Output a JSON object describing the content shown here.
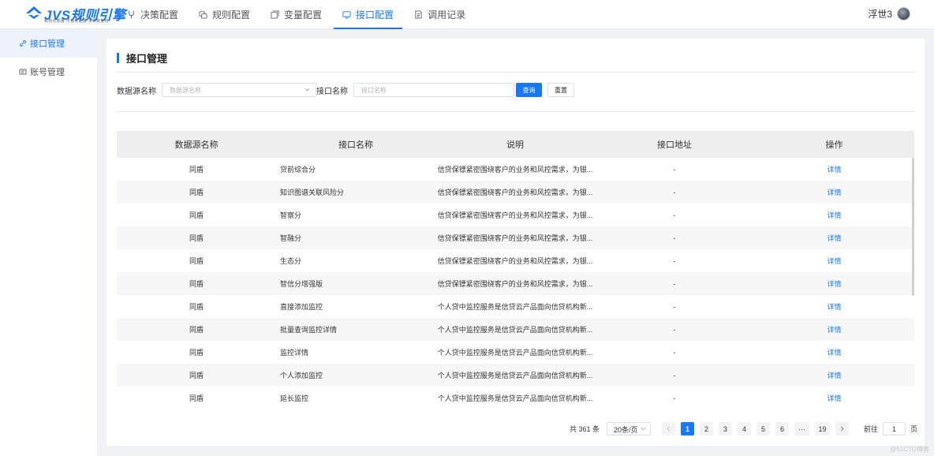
{
  "brand": {
    "name": "JVS规则引擎",
    "slogan": "私有化部署·可视化配置·多场景支持"
  },
  "nav": [
    {
      "label": "决策配置",
      "icon": "branch-icon",
      "active": false
    },
    {
      "label": "规则配置",
      "icon": "rules-icon",
      "active": false
    },
    {
      "label": "变量配置",
      "icon": "variable-icon",
      "active": false
    },
    {
      "label": "接口配置",
      "icon": "monitor-icon",
      "active": true
    },
    {
      "label": "调用记录",
      "icon": "document-icon",
      "active": false
    }
  ],
  "user": {
    "name": "浮世3"
  },
  "sidebar": [
    {
      "label": "接口管理",
      "icon": "link-icon",
      "active": true
    },
    {
      "label": "账号管理",
      "icon": "account-card-icon",
      "active": false
    }
  ],
  "page": {
    "title": "接口管理"
  },
  "filters": {
    "datasource_label": "数据源名称",
    "datasource_placeholder": "数据源名称",
    "api_label": "接口名称",
    "api_placeholder": "接口名称",
    "search_btn": "查询",
    "reset_btn": "重置"
  },
  "table": {
    "columns": [
      "数据源名称",
      "接口名称",
      "说明",
      "接口地址",
      "操作"
    ],
    "rows": [
      {
        "source": "同盾",
        "name": "贷前综合分",
        "desc": "信贷保镖紧密围绕客户的业务和风控需求，为银...",
        "url": "-",
        "action": "详情"
      },
      {
        "source": "同盾",
        "name": "知识图谱关联风险分",
        "desc": "信贷保镖紧密围绕客户的业务和风控需求，为银...",
        "url": "-",
        "action": "详情"
      },
      {
        "source": "同盾",
        "name": "智察分",
        "desc": "信贷保镖紧密围绕客户的业务和风控需求，为银...",
        "url": "-",
        "action": "详情"
      },
      {
        "source": "同盾",
        "name": "智融分",
        "desc": "信贷保镖紧密围绕客户的业务和风控需求，为银...",
        "url": "-",
        "action": "详情"
      },
      {
        "source": "同盾",
        "name": "生态分",
        "desc": "信贷保镖紧密围绕客户的业务和风控需求，为银...",
        "url": "-",
        "action": "详情"
      },
      {
        "source": "同盾",
        "name": "智信分增强版",
        "desc": "信贷保镖紧密围绕客户的业务和风控需求，为银...",
        "url": "-",
        "action": "详情"
      },
      {
        "source": "同盾",
        "name": "直接添加监控",
        "desc": "个人贷中监控服务是信贷云产品面向信贷机构新...",
        "url": "-",
        "action": "详情"
      },
      {
        "source": "同盾",
        "name": "批量查询监控详情",
        "desc": "个人贷中监控服务是信贷云产品面向信贷机构新...",
        "url": "-",
        "action": "详情"
      },
      {
        "source": "同盾",
        "name": "监控详情",
        "desc": "个人贷中监控服务是信贷云产品面向信贷机构新...",
        "url": "-",
        "action": "详情"
      },
      {
        "source": "同盾",
        "name": "个人添加监控",
        "desc": "个人贷中监控服务是信贷云产品面向信贷机构新...",
        "url": "-",
        "action": "详情"
      },
      {
        "source": "同盾",
        "name": "延长监控",
        "desc": "个人贷中监控服务是信贷云产品面向信贷机构新...",
        "url": "-",
        "action": "详情"
      }
    ]
  },
  "pagination": {
    "total_text": "共 361 条",
    "page_size": "20条/页",
    "pages": [
      "1",
      "2",
      "3",
      "4",
      "5",
      "6",
      "···",
      "19"
    ],
    "current": "1",
    "goto_label": "前往",
    "goto_value": "1",
    "goto_suffix": "页"
  },
  "watermark": "@51CTO博客",
  "colors": {
    "primary": "#1677ff",
    "header_bg": "#eeeeee"
  }
}
